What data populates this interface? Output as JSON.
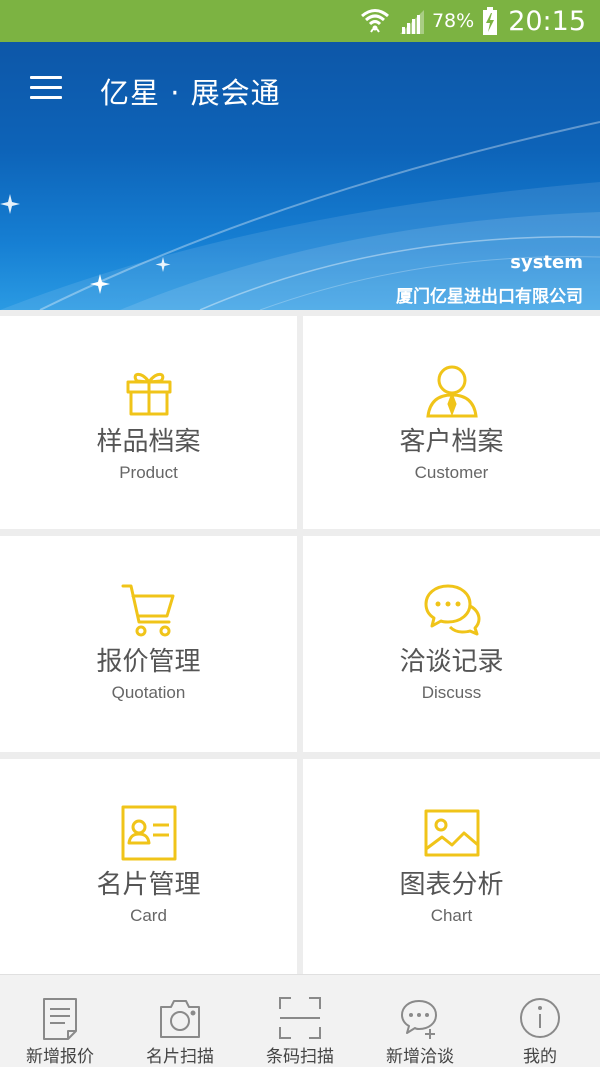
{
  "status_bar": {
    "battery": "78%",
    "time": "20:15",
    "icons": [
      "wifi-icon",
      "signal-icon",
      "battery-charging-icon"
    ]
  },
  "header": {
    "menu_icon": "hamburger-menu-icon",
    "title": "亿星 · 展会通",
    "user": "system",
    "company": "厦门亿星进出口有限公司",
    "colors": {
      "banner_dark": "#0d57a8",
      "banner_light": "#2a9ae3"
    }
  },
  "tiles": [
    {
      "cn": "样品档案",
      "en": "Product",
      "icon": "gift-icon"
    },
    {
      "cn": "客户档案",
      "en": "Customer",
      "icon": "person-icon"
    },
    {
      "cn": "报价管理",
      "en": "Quotation",
      "icon": "cart-icon"
    },
    {
      "cn": "洽谈记录",
      "en": "Discuss",
      "icon": "chat-icon"
    },
    {
      "cn": "名片管理",
      "en": "Card",
      "icon": "id-card-icon"
    },
    {
      "cn": "图表分析",
      "en": "Chart",
      "icon": "image-chart-icon"
    }
  ],
  "accent_color": "#f0c419",
  "bottom_nav": [
    {
      "label": "新增报价",
      "icon": "document-icon"
    },
    {
      "label": "名片扫描",
      "icon": "camera-icon"
    },
    {
      "label": "条码扫描",
      "icon": "scan-frame-icon"
    },
    {
      "label": "新增洽谈",
      "icon": "chat-add-icon"
    },
    {
      "label": "我的",
      "icon": "info-icon"
    }
  ]
}
